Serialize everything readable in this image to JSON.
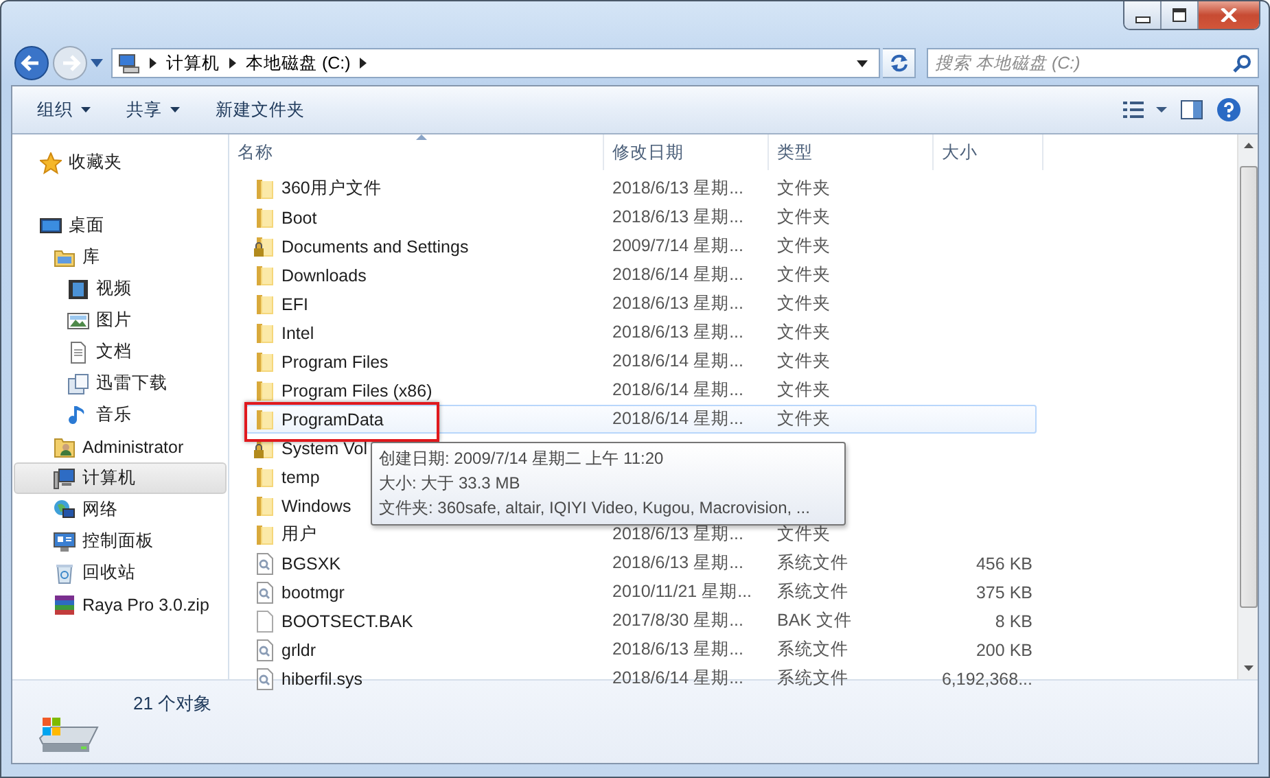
{
  "address": {
    "crumbs": [
      "计算机",
      "本地磁盘 (C:)"
    ]
  },
  "search": {
    "placeholder": "搜索 本地磁盘 (C:)"
  },
  "toolbar": [
    {
      "label": "组织",
      "dropdown": true
    },
    {
      "label": "共享",
      "dropdown": true
    },
    {
      "label": "新建文件夹",
      "dropdown": false
    }
  ],
  "sidebar": {
    "groups": [
      {
        "items": [
          {
            "label": "收藏夹",
            "kind": "favorites",
            "selected": false
          }
        ]
      },
      {
        "items": [
          {
            "label": "桌面",
            "kind": "desktop",
            "selected": false,
            "children": [
              {
                "label": "库",
                "kind": "library",
                "selected": false,
                "children": [
                  {
                    "label": "视频",
                    "kind": "video",
                    "selected": false
                  },
                  {
                    "label": "图片",
                    "kind": "pictures",
                    "selected": false
                  },
                  {
                    "label": "文档",
                    "kind": "documents",
                    "selected": false
                  },
                  {
                    "label": "迅雷下载",
                    "kind": "downloads",
                    "selected": false
                  },
                  {
                    "label": "音乐",
                    "kind": "music",
                    "selected": false
                  }
                ]
              },
              {
                "label": "Administrator",
                "kind": "user",
                "selected": false
              },
              {
                "label": "计算机",
                "kind": "computer",
                "selected": true
              },
              {
                "label": "网络",
                "kind": "network",
                "selected": false
              },
              {
                "label": "控制面板",
                "kind": "control_panel",
                "selected": false
              },
              {
                "label": "回收站",
                "kind": "recycle_bin",
                "selected": false
              },
              {
                "label": "Raya Pro 3.0.zip",
                "kind": "archive",
                "selected": false
              }
            ]
          }
        ]
      }
    ]
  },
  "table": {
    "columns": [
      {
        "label": "名称",
        "sorted": true
      },
      {
        "label": "修改日期",
        "sorted": false
      },
      {
        "label": "类型",
        "sorted": false
      },
      {
        "label": "大小",
        "sorted": false
      }
    ],
    "rows": [
      {
        "name": "360用户文件",
        "kind": "folder",
        "date": "2018/6/13 星期...",
        "type": "文件夹",
        "hover": false,
        "outlined": false
      },
      {
        "name": "Boot",
        "kind": "folder",
        "date": "2018/6/13 星期...",
        "type": "文件夹",
        "hover": false,
        "outlined": false
      },
      {
        "name": "Documents and Settings",
        "kind": "locked_folder",
        "date": "2009/7/14 星期...",
        "type": "文件夹",
        "hover": false,
        "outlined": false
      },
      {
        "name": "Downloads",
        "kind": "folder",
        "date": "2018/6/14 星期...",
        "type": "文件夹",
        "hover": false,
        "outlined": false
      },
      {
        "name": "EFI",
        "kind": "folder",
        "date": "2018/6/13 星期...",
        "type": "文件夹",
        "hover": false,
        "outlined": false
      },
      {
        "name": "Intel",
        "kind": "folder",
        "date": "2018/6/13 星期...",
        "type": "文件夹",
        "hover": false,
        "outlined": false
      },
      {
        "name": "Program Files",
        "kind": "folder",
        "date": "2018/6/14 星期...",
        "type": "文件夹",
        "hover": false,
        "outlined": false
      },
      {
        "name": "Program Files (x86)",
        "kind": "folder",
        "date": "2018/6/14 星期...",
        "type": "文件夹",
        "hover": false,
        "outlined": false
      },
      {
        "name": "ProgramData",
        "kind": "folder",
        "date": "2018/6/14 星期...",
        "type": "文件夹",
        "hover": true,
        "outlined": true
      },
      {
        "name": "System Vol",
        "kind": "locked_folder",
        "hover": false,
        "outlined": false
      },
      {
        "name": "temp",
        "kind": "folder",
        "hover": false,
        "outlined": false
      },
      {
        "name": "Windows",
        "kind": "folder",
        "hover": false,
        "outlined": false
      },
      {
        "name": "用户",
        "kind": "folder",
        "date": "2018/6/13 星期...",
        "type": "文件夹",
        "hover": false,
        "outlined": false
      },
      {
        "name": "BGSXK",
        "kind": "system_file",
        "date": "2018/6/13 星期...",
        "type": "系统文件",
        "size": "456 KB",
        "hover": false,
        "outlined": false
      },
      {
        "name": "bootmgr",
        "kind": "system_file",
        "date": "2010/11/21 星期...",
        "type": "系统文件",
        "size": "375 KB",
        "hover": false,
        "outlined": false
      },
      {
        "name": "BOOTSECT.BAK",
        "kind": "file",
        "date": "2017/8/30 星期...",
        "type": "BAK 文件",
        "size": "8 KB",
        "hover": false,
        "outlined": false
      },
      {
        "name": "grldr",
        "kind": "system_file",
        "date": "2018/6/13 星期...",
        "type": "系统文件",
        "size": "200 KB",
        "hover": false,
        "outlined": false
      },
      {
        "name": "hiberfil.sys",
        "kind": "system_file",
        "date": "2018/6/14 星期...",
        "type": "系统文件",
        "size": "6,192,368...",
        "hover": false,
        "outlined": false
      }
    ]
  },
  "tooltip": {
    "lines": [
      "创建日期: 2009/7/14 星期二 上午 11:20",
      "大小: 大于 33.3 MB",
      "文件夹: 360safe, altair, IQIYI Video, Kugou, Macrovision, ..."
    ]
  },
  "status_bar": {
    "count": "21 个对象"
  }
}
